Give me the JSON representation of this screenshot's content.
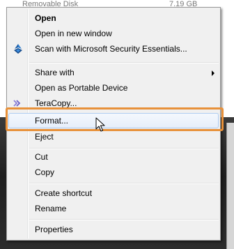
{
  "background": {
    "drive_name": "Removable Disk",
    "drive_size": "7.19 GB"
  },
  "context_menu": {
    "items": [
      {
        "label": "Open",
        "bold": true
      },
      {
        "label": "Open in new window"
      },
      {
        "label": "Scan with Microsoft Security Essentials...",
        "icon": "security-essentials-icon"
      },
      {
        "label": "Share with",
        "submenu": true
      },
      {
        "label": "Open as Portable Device"
      },
      {
        "label": "TeraCopy...",
        "icon": "teracopy-icon"
      },
      {
        "label": "Format...",
        "hovered": true
      },
      {
        "label": "Eject"
      },
      {
        "label": "Cut"
      },
      {
        "label": "Copy"
      },
      {
        "label": "Create shortcut"
      },
      {
        "label": "Rename"
      },
      {
        "label": "Properties"
      }
    ]
  },
  "highlight": {
    "color": "#e8913a",
    "target": "Format..."
  },
  "colors": {
    "menu_background": "#f0f0f0",
    "hover_border": "#aeccf1"
  }
}
